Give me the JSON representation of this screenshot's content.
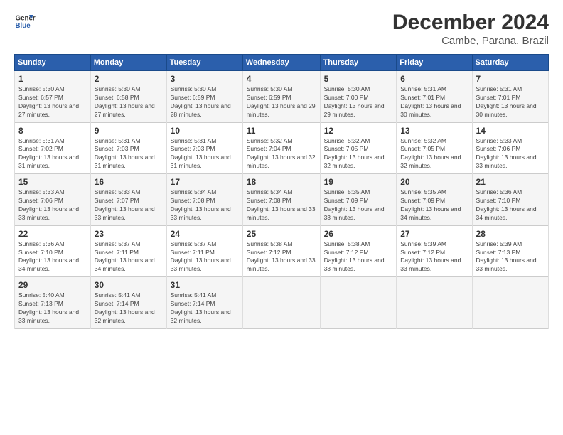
{
  "header": {
    "logo_line1": "General",
    "logo_line2": "Blue",
    "month": "December 2024",
    "location": "Cambe, Parana, Brazil"
  },
  "weekdays": [
    "Sunday",
    "Monday",
    "Tuesday",
    "Wednesday",
    "Thursday",
    "Friday",
    "Saturday"
  ],
  "weeks": [
    [
      {
        "day": "1",
        "sunrise": "Sunrise: 5:30 AM",
        "sunset": "Sunset: 6:57 PM",
        "daylight": "Daylight: 13 hours and 27 minutes."
      },
      {
        "day": "2",
        "sunrise": "Sunrise: 5:30 AM",
        "sunset": "Sunset: 6:58 PM",
        "daylight": "Daylight: 13 hours and 27 minutes."
      },
      {
        "day": "3",
        "sunrise": "Sunrise: 5:30 AM",
        "sunset": "Sunset: 6:59 PM",
        "daylight": "Daylight: 13 hours and 28 minutes."
      },
      {
        "day": "4",
        "sunrise": "Sunrise: 5:30 AM",
        "sunset": "Sunset: 6:59 PM",
        "daylight": "Daylight: 13 hours and 29 minutes."
      },
      {
        "day": "5",
        "sunrise": "Sunrise: 5:30 AM",
        "sunset": "Sunset: 7:00 PM",
        "daylight": "Daylight: 13 hours and 29 minutes."
      },
      {
        "day": "6",
        "sunrise": "Sunrise: 5:31 AM",
        "sunset": "Sunset: 7:01 PM",
        "daylight": "Daylight: 13 hours and 30 minutes."
      },
      {
        "day": "7",
        "sunrise": "Sunrise: 5:31 AM",
        "sunset": "Sunset: 7:01 PM",
        "daylight": "Daylight: 13 hours and 30 minutes."
      }
    ],
    [
      {
        "day": "8",
        "sunrise": "Sunrise: 5:31 AM",
        "sunset": "Sunset: 7:02 PM",
        "daylight": "Daylight: 13 hours and 31 minutes."
      },
      {
        "day": "9",
        "sunrise": "Sunrise: 5:31 AM",
        "sunset": "Sunset: 7:03 PM",
        "daylight": "Daylight: 13 hours and 31 minutes."
      },
      {
        "day": "10",
        "sunrise": "Sunrise: 5:31 AM",
        "sunset": "Sunset: 7:03 PM",
        "daylight": "Daylight: 13 hours and 31 minutes."
      },
      {
        "day": "11",
        "sunrise": "Sunrise: 5:32 AM",
        "sunset": "Sunset: 7:04 PM",
        "daylight": "Daylight: 13 hours and 32 minutes."
      },
      {
        "day": "12",
        "sunrise": "Sunrise: 5:32 AM",
        "sunset": "Sunset: 7:05 PM",
        "daylight": "Daylight: 13 hours and 32 minutes."
      },
      {
        "day": "13",
        "sunrise": "Sunrise: 5:32 AM",
        "sunset": "Sunset: 7:05 PM",
        "daylight": "Daylight: 13 hours and 32 minutes."
      },
      {
        "day": "14",
        "sunrise": "Sunrise: 5:33 AM",
        "sunset": "Sunset: 7:06 PM",
        "daylight": "Daylight: 13 hours and 33 minutes."
      }
    ],
    [
      {
        "day": "15",
        "sunrise": "Sunrise: 5:33 AM",
        "sunset": "Sunset: 7:06 PM",
        "daylight": "Daylight: 13 hours and 33 minutes."
      },
      {
        "day": "16",
        "sunrise": "Sunrise: 5:33 AM",
        "sunset": "Sunset: 7:07 PM",
        "daylight": "Daylight: 13 hours and 33 minutes."
      },
      {
        "day": "17",
        "sunrise": "Sunrise: 5:34 AM",
        "sunset": "Sunset: 7:08 PM",
        "daylight": "Daylight: 13 hours and 33 minutes."
      },
      {
        "day": "18",
        "sunrise": "Sunrise: 5:34 AM",
        "sunset": "Sunset: 7:08 PM",
        "daylight": "Daylight: 13 hours and 33 minutes."
      },
      {
        "day": "19",
        "sunrise": "Sunrise: 5:35 AM",
        "sunset": "Sunset: 7:09 PM",
        "daylight": "Daylight: 13 hours and 33 minutes."
      },
      {
        "day": "20",
        "sunrise": "Sunrise: 5:35 AM",
        "sunset": "Sunset: 7:09 PM",
        "daylight": "Daylight: 13 hours and 34 minutes."
      },
      {
        "day": "21",
        "sunrise": "Sunrise: 5:36 AM",
        "sunset": "Sunset: 7:10 PM",
        "daylight": "Daylight: 13 hours and 34 minutes."
      }
    ],
    [
      {
        "day": "22",
        "sunrise": "Sunrise: 5:36 AM",
        "sunset": "Sunset: 7:10 PM",
        "daylight": "Daylight: 13 hours and 34 minutes."
      },
      {
        "day": "23",
        "sunrise": "Sunrise: 5:37 AM",
        "sunset": "Sunset: 7:11 PM",
        "daylight": "Daylight: 13 hours and 34 minutes."
      },
      {
        "day": "24",
        "sunrise": "Sunrise: 5:37 AM",
        "sunset": "Sunset: 7:11 PM",
        "daylight": "Daylight: 13 hours and 33 minutes."
      },
      {
        "day": "25",
        "sunrise": "Sunrise: 5:38 AM",
        "sunset": "Sunset: 7:12 PM",
        "daylight": "Daylight: 13 hours and 33 minutes."
      },
      {
        "day": "26",
        "sunrise": "Sunrise: 5:38 AM",
        "sunset": "Sunset: 7:12 PM",
        "daylight": "Daylight: 13 hours and 33 minutes."
      },
      {
        "day": "27",
        "sunrise": "Sunrise: 5:39 AM",
        "sunset": "Sunset: 7:12 PM",
        "daylight": "Daylight: 13 hours and 33 minutes."
      },
      {
        "day": "28",
        "sunrise": "Sunrise: 5:39 AM",
        "sunset": "Sunset: 7:13 PM",
        "daylight": "Daylight: 13 hours and 33 minutes."
      }
    ],
    [
      {
        "day": "29",
        "sunrise": "Sunrise: 5:40 AM",
        "sunset": "Sunset: 7:13 PM",
        "daylight": "Daylight: 13 hours and 33 minutes."
      },
      {
        "day": "30",
        "sunrise": "Sunrise: 5:41 AM",
        "sunset": "Sunset: 7:14 PM",
        "daylight": "Daylight: 13 hours and 32 minutes."
      },
      {
        "day": "31",
        "sunrise": "Sunrise: 5:41 AM",
        "sunset": "Sunset: 7:14 PM",
        "daylight": "Daylight: 13 hours and 32 minutes."
      },
      null,
      null,
      null,
      null
    ]
  ]
}
